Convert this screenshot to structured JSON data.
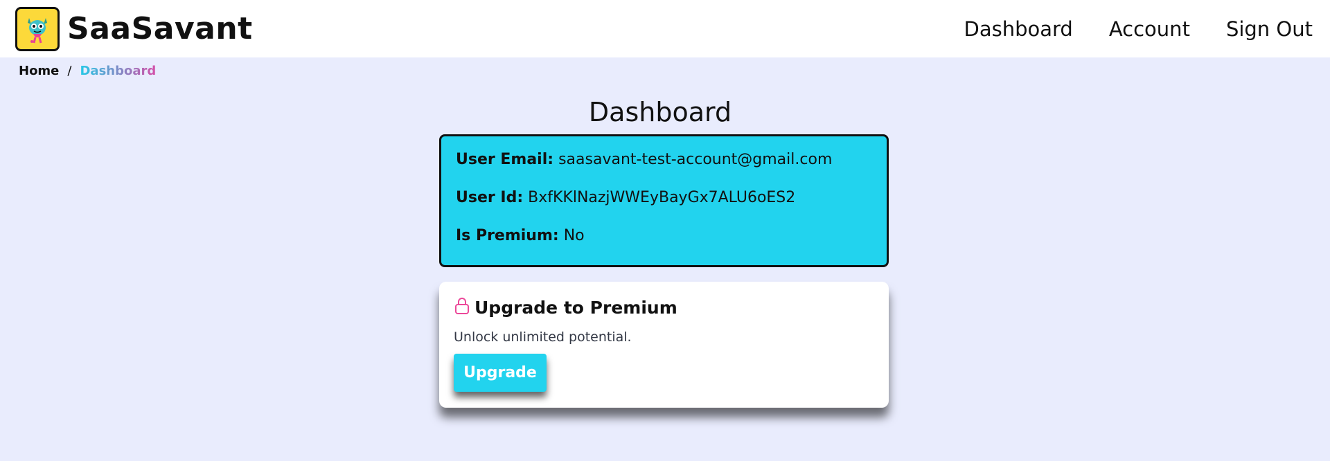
{
  "header": {
    "brand_name": "SaaSavant",
    "logo_icon": "monster-mascot-icon",
    "nav": [
      {
        "label": "Dashboard"
      },
      {
        "label": "Account"
      },
      {
        "label": "Sign Out"
      }
    ]
  },
  "breadcrumb": {
    "home": "Home",
    "separator": "/",
    "current": "Dashboard"
  },
  "main": {
    "title": "Dashboard",
    "user_info": {
      "email_label": "User Email:",
      "email_value": "saasavant-test-account@gmail.com",
      "id_label": "User Id:",
      "id_value": "BxfKKlNazjWWEyBayGx7ALU6oES2",
      "premium_label": "Is Premium:",
      "premium_value": "No"
    },
    "upgrade": {
      "icon": "lock-icon",
      "title": "Upgrade to Premium",
      "description": "Unlock unlimited potential.",
      "button_label": "Upgrade"
    }
  },
  "colors": {
    "background": "#e9ecfd",
    "accent_cyan": "#22d3ee",
    "logo_yellow": "#fcd93a",
    "lock_pink": "#ec4899"
  }
}
